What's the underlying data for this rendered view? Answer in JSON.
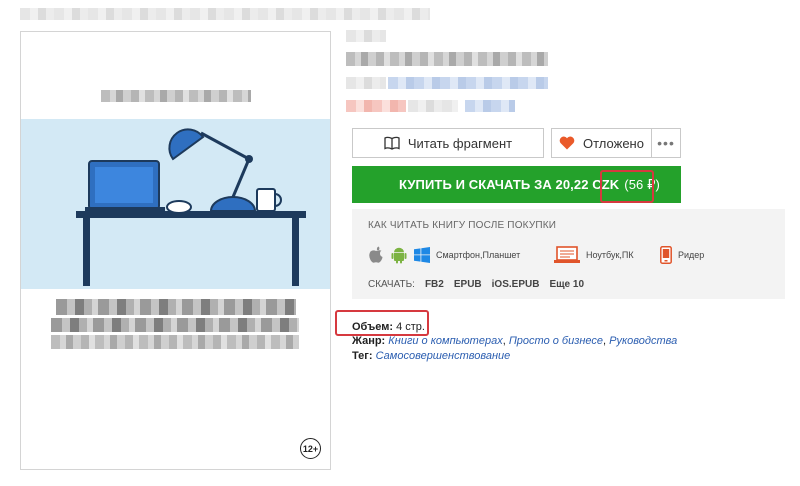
{
  "buttons": {
    "read_fragment": "Читать фрагмент",
    "favorite": "Отложено",
    "more": "•••"
  },
  "buy": {
    "label": "КУПИТЬ И СКАЧАТЬ ЗА 20,22 CZK",
    "alt_price": "(56 ₽)"
  },
  "how_to_read": {
    "title": "КАК ЧИТАТЬ КНИГУ ПОСЛЕ ПОКУПКИ",
    "platforms": [
      "Смартфон,Планшет",
      "Ноутбук,ПК",
      "Ридер"
    ],
    "download_label": "СКАЧАТЬ:",
    "formats": [
      "FB2",
      "EPUB",
      "iOS.EPUB",
      "Еще 10"
    ]
  },
  "meta": {
    "volume_label": "Объем:",
    "volume_value": "4 стр.",
    "genre_label": "Жанр:",
    "genre_links": [
      "Книги о компьютерах",
      "Просто о бизнесе",
      "Руководства"
    ],
    "genre_sep": ", ",
    "tag_label": "Тег:",
    "tag_link": "Самосовершенствование"
  },
  "cover": {
    "age_rating": "12+"
  },
  "colors": {
    "buy_green": "#24a12b",
    "highlight_red": "#d6393f",
    "link_blue": "#2a5db0",
    "cover_bg": "#d3e9f5"
  }
}
